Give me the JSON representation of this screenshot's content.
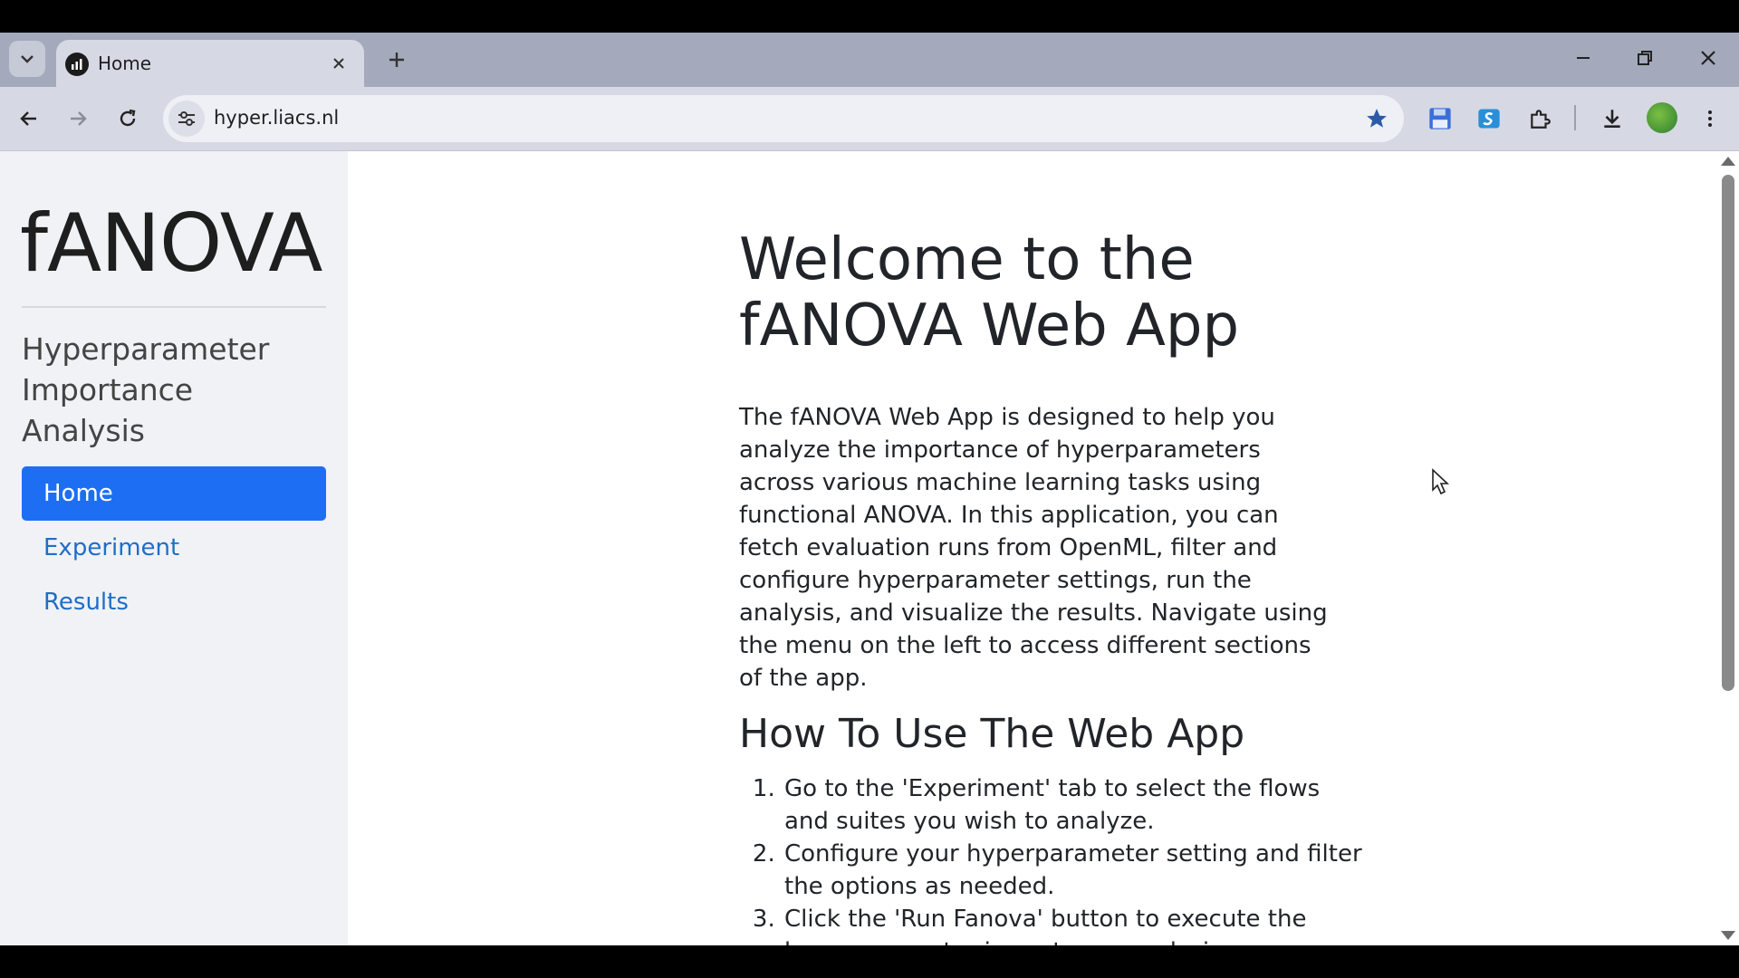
{
  "browser": {
    "tab": {
      "title": "Home"
    },
    "address": {
      "url": "hyper.liacs.nl"
    },
    "colors": {
      "tabstrip": "#a5a9bc",
      "toolbar": "#d6d9e3",
      "accent": "#1e6ef4"
    }
  },
  "sidebar": {
    "brand": "fANOVA",
    "subtitle": "Hyperparameter Importance Analysis",
    "nav": [
      {
        "label": "Home",
        "active": true
      },
      {
        "label": "Experiment",
        "active": false
      },
      {
        "label": "Results",
        "active": false
      }
    ]
  },
  "main": {
    "title": "Welcome to the fANOVA Web App",
    "intro": "The fANOVA Web App is designed to help you analyze the importance of hyperparameters across various machine learning tasks using functional ANOVA. In this application, you can fetch evaluation runs from OpenML, filter and configure hyperparameter settings, run the analysis, and visualize the results. Navigate using the menu on the left to access different sections of the app.",
    "howto_title": "How To Use The Web App",
    "steps": [
      "Go to the 'Experiment' tab to select the flows and suites you wish to analyze.",
      "Configure your hyperparameter setting and filter the options as needed.",
      "Click the 'Run Fanova' button to execute the hyperparameter importance analysis."
    ]
  },
  "icons": [
    "tab-search-icon",
    "favicon-icon",
    "close-icon",
    "plus-icon",
    "minimize-icon",
    "restore-icon",
    "window-close-icon",
    "back-arrow-icon",
    "forward-arrow-icon",
    "reload-icon",
    "tune-icon",
    "star-icon",
    "save-icon",
    "screencast-icon",
    "puzzle-icon",
    "download-icon",
    "profile-avatar-icon",
    "more-vert-icon",
    "cursor-icon"
  ]
}
